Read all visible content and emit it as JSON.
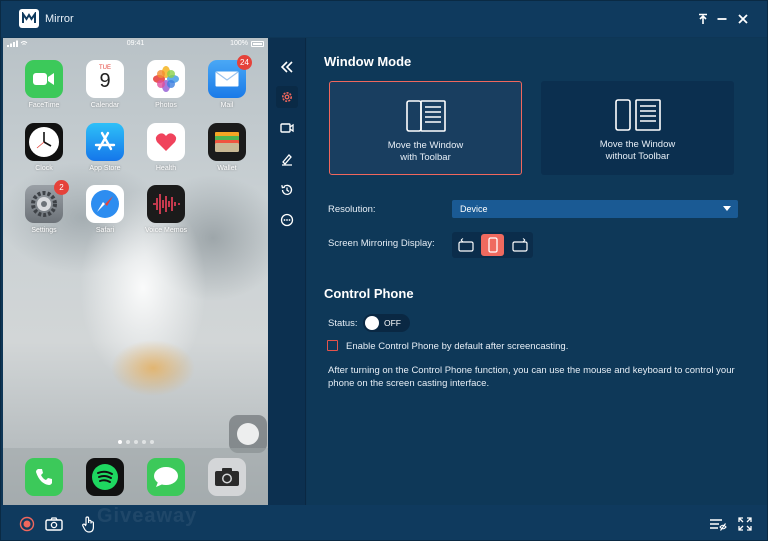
{
  "titlebar": {
    "app_name": "Mirror"
  },
  "phone": {
    "status": {
      "time": "09:41",
      "battery": "100%"
    },
    "apps": [
      {
        "name": "FaceTime",
        "badge": ""
      },
      {
        "name": "Calendar",
        "badge": "",
        "day": "TUE",
        "date": "9"
      },
      {
        "name": "Photos",
        "badge": ""
      },
      {
        "name": "Mail",
        "badge": "24"
      },
      {
        "name": "Clock",
        "badge": ""
      },
      {
        "name": "App Store",
        "badge": ""
      },
      {
        "name": "Health",
        "badge": ""
      },
      {
        "name": "Wallet",
        "badge": ""
      },
      {
        "name": "Settings",
        "badge": "2"
      },
      {
        "name": "Safari",
        "badge": ""
      },
      {
        "name": "Voice Memos",
        "badge": ""
      }
    ],
    "page_count": 5,
    "active_page": 1,
    "dock": [
      "phone-app",
      "spotify-app",
      "messages-app",
      "camera-app"
    ]
  },
  "side_toolbar": {
    "items": [
      "collapse-icon",
      "settings-icon",
      "record-icon",
      "draw-icon",
      "history-icon",
      "more-icon"
    ],
    "active": "settings-icon"
  },
  "settings": {
    "window_mode": {
      "heading": "Window Mode",
      "options": [
        {
          "line1": "Move the Window",
          "line2": "with Toolbar",
          "selected": true
        },
        {
          "line1": "Move the Window",
          "line2": "without Toolbar",
          "selected": false
        }
      ]
    },
    "resolution": {
      "label": "Resolution:",
      "value": "Device"
    },
    "display": {
      "label": "Screen Mirroring Display:",
      "selected": "portrait"
    },
    "control_phone": {
      "heading": "Control Phone",
      "status_label": "Status:",
      "toggle_text": "OFF",
      "checkbox_label": "Enable Control Phone by default after screencasting.",
      "checkbox_checked": false,
      "description": "After turning on the Control Phone function, you can use the mouse and keyboard to control your phone on the screen casting interface."
    }
  },
  "bottombar": {
    "watermark": "Giveaway"
  },
  "colors": {
    "accent": "#ef6a5f",
    "background": "#0e3656",
    "select": "#1a5a94"
  }
}
